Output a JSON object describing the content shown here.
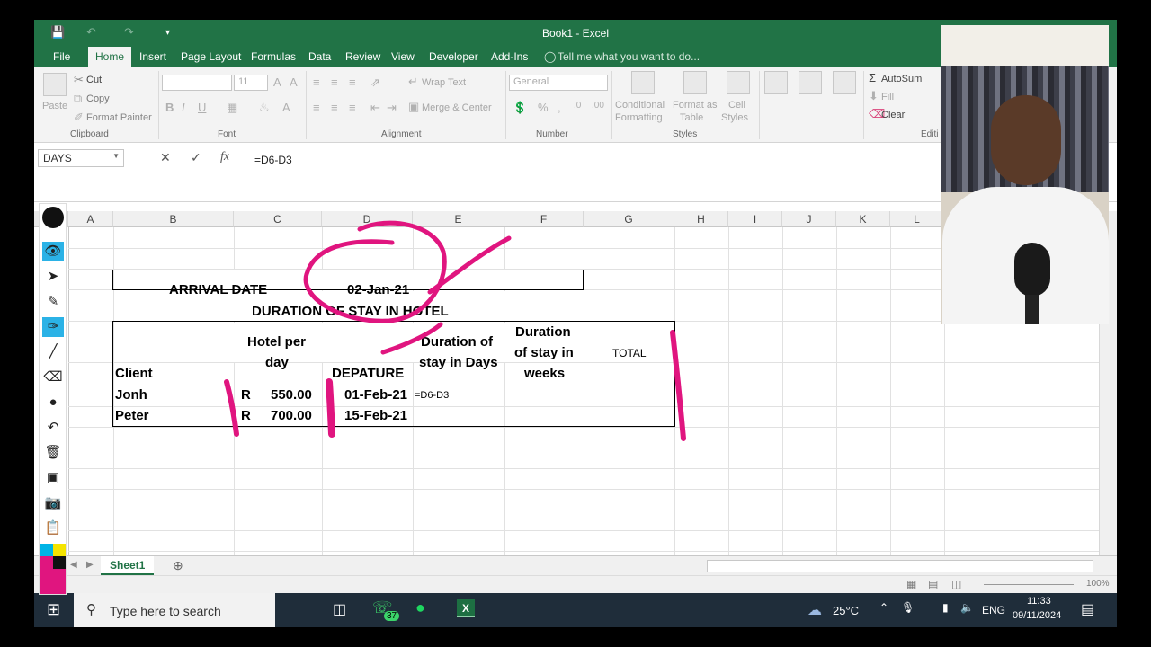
{
  "window": {
    "title": "Book1 - Excel"
  },
  "ribbon_tabs": [
    "File",
    "Home",
    "Insert",
    "Page Layout",
    "Formulas",
    "Data",
    "Review",
    "View",
    "Developer",
    "Add-Ins"
  ],
  "tell_me": "Tell me what you want to do...",
  "clipboard": {
    "paste": "Paste",
    "cut": "Cut",
    "copy": "Copy",
    "format_painter": "Format Painter",
    "label": "Clipboard"
  },
  "font": {
    "size": "11",
    "label": "Font"
  },
  "alignment": {
    "wrap_text": "Wrap Text",
    "merge_center": "Merge & Center",
    "label": "Alignment"
  },
  "number": {
    "format": "General",
    "label": "Number"
  },
  "styles": {
    "conditional": [
      "Conditional",
      "Formatting"
    ],
    "format_as_table": [
      "Format as",
      "Table"
    ],
    "cell_styles": [
      "Cell",
      "Styles"
    ],
    "label": "Styles"
  },
  "cells": {
    "arrival_label": "ARRIVAL DATE",
    "arrival_date": "02-Jan-21",
    "duration_title": "DURATION OF STAY IN HOTEL",
    "hdr_client": "Client",
    "hdr_hotel_1": "Hotel per",
    "hdr_hotel_2": "day",
    "hdr_departure": "DEPATURE",
    "hdr_days_1": "Duration of",
    "hdr_days_2": "stay in Days",
    "hdr_weeks_1": "Duration",
    "hdr_weeks_2": "of stay in",
    "hdr_weeks_3": "weeks",
    "hdr_total": "TOTAL",
    "rows": [
      {
        "client": "Jonh",
        "currency": "R",
        "rate": "550.00",
        "departure": "01-Feb-21",
        "days": "=D6-D3"
      },
      {
        "client": "Peter",
        "currency": "R",
        "rate": "700.00",
        "departure": "15-Feb-21",
        "days": ""
      }
    ]
  },
  "editing": {
    "autosum": "AutoSum",
    "fill": "Fill",
    "clear": "Clear",
    "label": "Editi"
  },
  "name_box": "DAYS",
  "formula": "=D6-D3",
  "fx": "fx",
  "columns": [
    "A",
    "B",
    "C",
    "D",
    "E",
    "F",
    "G",
    "H",
    "I",
    "J",
    "K",
    "L"
  ],
  "sheet_tab": "Sheet1",
  "status": {
    "zoom": "100%"
  },
  "taskbar": {
    "search": "Type here to search",
    "badge": "37",
    "weather": "25°C",
    "lang": "ENG",
    "time": "11:33",
    "date": "09/11/2024"
  },
  "colors": {
    "excel_green": "#217346",
    "annotation_pink": "#e0157f"
  }
}
